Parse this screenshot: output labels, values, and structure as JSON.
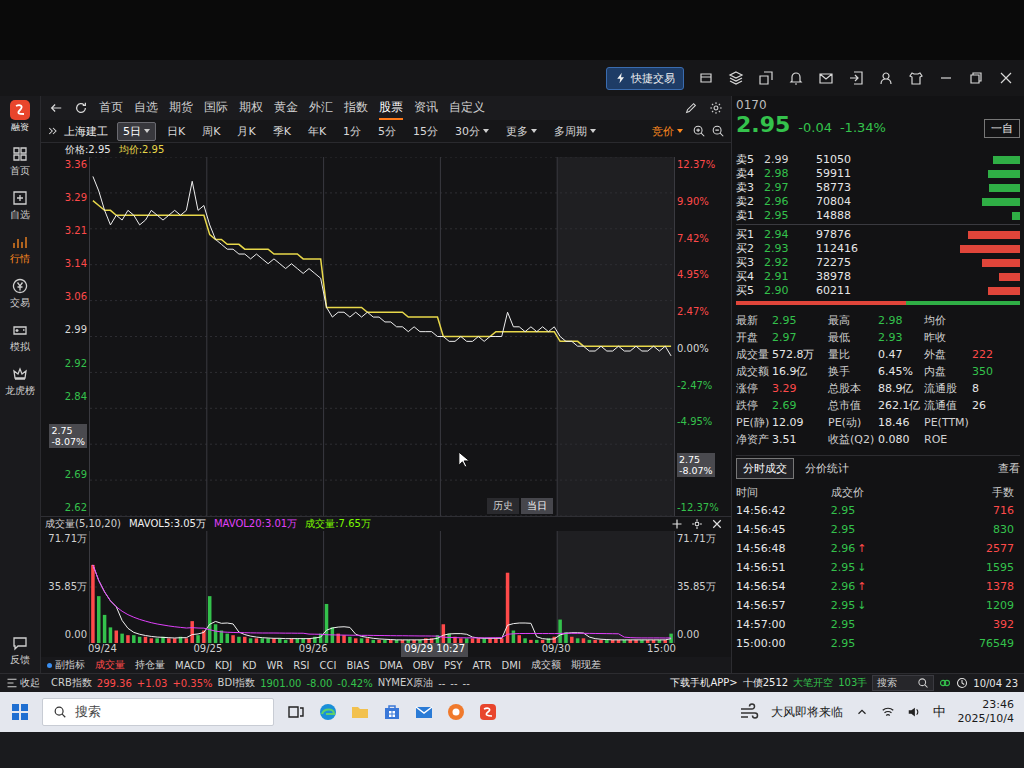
{
  "title_bar": {
    "quick_trade": "快捷交易"
  },
  "sidebar": {
    "logo": "融资",
    "items": [
      {
        "label": "首页",
        "selected": false
      },
      {
        "label": "自选",
        "selected": false
      },
      {
        "label": "行情",
        "selected": true
      },
      {
        "label": "交易",
        "selected": false
      },
      {
        "label": "模拟",
        "selected": false
      },
      {
        "label": "龙虎榜",
        "selected": false
      }
    ],
    "feedback": "反馈"
  },
  "nav": {
    "items": [
      {
        "label": "首页",
        "selected": false
      },
      {
        "label": "自选",
        "selected": false
      },
      {
        "label": "期货",
        "selected": false
      },
      {
        "label": "国际",
        "selected": false
      },
      {
        "label": "期权",
        "selected": false
      },
      {
        "label": "黄金",
        "selected": false
      },
      {
        "label": "外汇",
        "selected": false
      },
      {
        "label": "指数",
        "selected": false
      },
      {
        "label": "股票",
        "selected": true
      },
      {
        "label": "资讯",
        "selected": false
      },
      {
        "label": "自定义",
        "selected": false
      }
    ]
  },
  "toolbar": {
    "stock": "上海建工",
    "periods": [
      {
        "label": "5日",
        "selected": true,
        "dropdown": true
      },
      {
        "label": "日K",
        "selected": false,
        "dropdown": false
      },
      {
        "label": "周K",
        "selected": false,
        "dropdown": false
      },
      {
        "label": "月K",
        "selected": false,
        "dropdown": false
      },
      {
        "label": "季K",
        "selected": false,
        "dropdown": false
      },
      {
        "label": "年K",
        "selected": false,
        "dropdown": false
      },
      {
        "label": "1分",
        "selected": false,
        "dropdown": false
      },
      {
        "label": "5分",
        "selected": false,
        "dropdown": false
      },
      {
        "label": "15分",
        "selected": false,
        "dropdown": false
      },
      {
        "label": "30分",
        "selected": false,
        "dropdown": true
      },
      {
        "label": "更多",
        "selected": false,
        "dropdown": true
      },
      {
        "label": "多周期",
        "selected": false,
        "dropdown": true
      }
    ],
    "auction": "竞价"
  },
  "chart": {
    "header": {
      "price": "价格:2.95",
      "avg": "均价:2.95"
    },
    "left_ticks": [
      {
        "kind": "tick",
        "text": "3.36",
        "color": "#ff4a4a"
      },
      {
        "kind": "tick",
        "text": "3.29",
        "color": "#ff4a4a"
      },
      {
        "kind": "tick",
        "text": "3.21",
        "color": "#ff4a4a"
      },
      {
        "kind": "tick",
        "text": "3.14",
        "color": "#ff4a4a"
      },
      {
        "kind": "tick",
        "text": "3.06",
        "color": "#ff4a4a"
      },
      {
        "kind": "tick",
        "text": "2.99",
        "color": "#d8d8d8"
      },
      {
        "kind": "tick",
        "text": "2.92",
        "color": "#34c24c"
      },
      {
        "kind": "tick",
        "text": "2.84",
        "color": "#34c24c"
      },
      {
        "kind": "cursor",
        "text": "2.75",
        "sub": "-8.07%",
        "color": "#ffffff"
      },
      {
        "kind": "tick",
        "text": "2.69",
        "color": "#34c24c"
      },
      {
        "kind": "tick",
        "text": "2.62",
        "color": "#34c24c"
      }
    ],
    "right_ticks": [
      {
        "kind": "tick",
        "text": "12.37%",
        "color": "#ff4a4a"
      },
      {
        "kind": "tick",
        "text": "9.90%",
        "color": "#ff4a4a"
      },
      {
        "kind": "tick",
        "text": "7.42%",
        "color": "#ff4a4a"
      },
      {
        "kind": "tick",
        "text": "4.95%",
        "color": "#ff4a4a"
      },
      {
        "kind": "tick",
        "text": "2.47%",
        "color": "#ff4a4a"
      },
      {
        "kind": "tick",
        "text": "0.00%",
        "color": "#d8d8d8"
      },
      {
        "kind": "tick",
        "text": "-2.47%",
        "color": "#34c24c"
      },
      {
        "kind": "tick",
        "text": "-4.95%",
        "color": "#34c24c"
      },
      {
        "kind": "cursor",
        "text": "2.75",
        "sub": "-8.07%",
        "color": "#ffffff"
      },
      {
        "kind": "tick",
        "text": "-12.37%",
        "color": "#34c24c"
      }
    ],
    "range": {
      "min": 2.62,
      "max": 3.36
    },
    "days": 5,
    "price": [
      3.32,
      3.29,
      3.25,
      3.22,
      3.24,
      3.23,
      3.25,
      3.24,
      3.22,
      3.23,
      3.25,
      3.24,
      3.23,
      3.24,
      3.25,
      3.24,
      3.25,
      3.31,
      3.25,
      3.26,
      3.22,
      3.19,
      3.18,
      3.17,
      3.17,
      3.16,
      3.16,
      3.15,
      3.16,
      3.15,
      3.14,
      3.15,
      3.14,
      3.13,
      3.14,
      3.13,
      3.12,
      3.13,
      3.12,
      3.11,
      3.05,
      3.03,
      3.04,
      3.04,
      3.03,
      3.04,
      3.03,
      3.04,
      3.03,
      3.03,
      3.02,
      3.02,
      3.01,
      3.01,
      3.0,
      3.01,
      3.0,
      3.0,
      3.0,
      2.99,
      2.99,
      2.98,
      2.98,
      2.99,
      2.98,
      2.98,
      2.99,
      2.98,
      2.99,
      2.99,
      2.99,
      3.04,
      3.01,
      3.01,
      3.0,
      3.01,
      3.0,
      3.01,
      3.0,
      3.01,
      2.99,
      2.98,
      2.98,
      2.97,
      2.97,
      2.96,
      2.96,
      2.97,
      2.96,
      2.96,
      2.97,
      2.96,
      2.96,
      2.97,
      2.96,
      2.96,
      2.97,
      2.96,
      2.97,
      2.95
    ],
    "avg": [
      3.27,
      3.26,
      3.25,
      3.25,
      3.24,
      3.24,
      3.24,
      3.24,
      3.24,
      3.24,
      3.24,
      3.24,
      3.24,
      3.24,
      3.24,
      3.24,
      3.24,
      3.24,
      3.24,
      3.24,
      3.2,
      3.19,
      3.19,
      3.18,
      3.18,
      3.18,
      3.17,
      3.17,
      3.17,
      3.17,
      3.17,
      3.16,
      3.16,
      3.16,
      3.16,
      3.16,
      3.15,
      3.15,
      3.15,
      3.15,
      3.05,
      3.05,
      3.05,
      3.05,
      3.05,
      3.05,
      3.05,
      3.04,
      3.04,
      3.04,
      3.04,
      3.04,
      3.04,
      3.04,
      3.03,
      3.03,
      3.03,
      3.03,
      3.03,
      3.03,
      2.99,
      2.99,
      2.99,
      2.99,
      2.99,
      2.99,
      2.99,
      2.99,
      2.99,
      3.0,
      3.0,
      3.0,
      3.0,
      3.0,
      3.0,
      3.0,
      3.0,
      3.0,
      3.0,
      3.0,
      2.98,
      2.98,
      2.98,
      2.98,
      2.97,
      2.97,
      2.97,
      2.97,
      2.97,
      2.97,
      2.97,
      2.97,
      2.97,
      2.97,
      2.97,
      2.97,
      2.97,
      2.97,
      2.97,
      2.97
    ],
    "buttons": [
      {
        "label": "历史",
        "selected": false
      },
      {
        "label": "当日",
        "selected": true
      }
    ]
  },
  "volume": {
    "header": [
      {
        "text": "成交量(5,10,20)",
        "color": "#d0d0d0"
      },
      {
        "text": "MAVOL5:3.05万",
        "color": "#f0f0f0"
      },
      {
        "text": "MAVOL20:3.01万",
        "color": "#e040fb"
      },
      {
        "text": "成交量:7.65万",
        "color": "#7cfc00"
      }
    ],
    "left_ticks": [
      "71.71万",
      "35.85万",
      "0.00"
    ],
    "right_ticks": [
      "71.71万",
      "35.85万",
      "0.00"
    ],
    "max": 71.71,
    "values": [
      50,
      30,
      18,
      10,
      8,
      6,
      5,
      5,
      4,
      4,
      3,
      3,
      4,
      3,
      3,
      4,
      3,
      14,
      5,
      8,
      30,
      12,
      8,
      6,
      5,
      4,
      4,
      3,
      3,
      3,
      3,
      3,
      3,
      2,
      3,
      3,
      3,
      3,
      4,
      6,
      25,
      10,
      6,
      5,
      4,
      3,
      3,
      3,
      2,
      2,
      2,
      2,
      2,
      2,
      2,
      2,
      2,
      3,
      3,
      5,
      12,
      6,
      4,
      3,
      3,
      3,
      3,
      3,
      3,
      3,
      3,
      45,
      8,
      5,
      3,
      2,
      2,
      2,
      3,
      4,
      15,
      7,
      4,
      3,
      3,
      2,
      2,
      2,
      2,
      2,
      2,
      2,
      2,
      2,
      2,
      2,
      2,
      2,
      2,
      6
    ],
    "dates": [
      {
        "text": "09/24",
        "selected": false
      },
      {
        "text": "09/25",
        "selected": false
      },
      {
        "text": "09/26",
        "selected": false
      },
      {
        "text": "09/29 10:27",
        "selected": true
      },
      {
        "text": "09/30",
        "selected": false
      },
      {
        "text": "15:00",
        "selected": false
      }
    ]
  },
  "indicators": {
    "label": "副指标",
    "tabs": [
      {
        "label": "成交量",
        "selected": true
      },
      {
        "label": "持仓量",
        "selected": false
      },
      {
        "label": "MACD",
        "selected": false
      },
      {
        "label": "KDJ",
        "selected": false
      },
      {
        "label": "KD",
        "selected": false
      },
      {
        "label": "WR",
        "selected": false
      },
      {
        "label": "RSI",
        "selected": false
      },
      {
        "label": "CCI",
        "selected": false
      },
      {
        "label": "BIAS",
        "selected": false
      },
      {
        "label": "DMA",
        "selected": false
      },
      {
        "label": "OBV",
        "selected": false
      },
      {
        "label": "PSY",
        "selected": false
      },
      {
        "label": "ATR",
        "selected": false
      },
      {
        "label": "DMI",
        "selected": false
      },
      {
        "label": "成交额",
        "selected": false
      },
      {
        "label": "期现差",
        "selected": false
      }
    ]
  },
  "quote": {
    "code": "0170",
    "price": "2.95",
    "change": "-0.04",
    "pct": "-1.34%",
    "color": "#34c24c",
    "button": "一自"
  },
  "order_book": {
    "asks": [
      {
        "label": "卖5",
        "price": "2.99",
        "price_color": "#d8d8d8",
        "volume": "51050",
        "level": 0.45
      },
      {
        "label": "卖4",
        "price": "2.98",
        "price_color": "#34c24c",
        "volume": "59911",
        "level": 0.53
      },
      {
        "label": "卖3",
        "price": "2.97",
        "price_color": "#34c24c",
        "volume": "58773",
        "level": 0.52
      },
      {
        "label": "卖2",
        "price": "2.96",
        "price_color": "#34c24c",
        "volume": "70804",
        "level": 0.63
      },
      {
        "label": "卖1",
        "price": "2.95",
        "price_color": "#34c24c",
        "volume": "14888",
        "level": 0.13
      }
    ],
    "bids": [
      {
        "label": "买1",
        "price": "2.94",
        "price_color": "#34c24c",
        "volume": "97876",
        "level": 0.87
      },
      {
        "label": "买2",
        "price": "2.93",
        "price_color": "#34c24c",
        "volume": "112416",
        "level": 1.0
      },
      {
        "label": "买3",
        "price": "2.92",
        "price_color": "#34c24c",
        "volume": "72275",
        "level": 0.64
      },
      {
        "label": "买4",
        "price": "2.91",
        "price_color": "#34c24c",
        "volume": "38978",
        "level": 0.35
      },
      {
        "label": "买5",
        "price": "2.90",
        "price_color": "#34c24c",
        "volume": "60211",
        "level": 0.54
      }
    ],
    "ratio": {
      "level": 0.6
    }
  },
  "stats": [
    [
      {
        "label": "最新",
        "value": "2.95",
        "color": "#34c24c"
      },
      {
        "label": "最高",
        "value": "2.98",
        "color": "#34c24c"
      },
      {
        "label": "均价"
      }
    ],
    [
      {
        "label": "开盘",
        "value": "2.97",
        "color": "#34c24c"
      },
      {
        "label": "最低",
        "value": "2.93",
        "color": "#34c24c"
      },
      {
        "label": "昨收"
      }
    ],
    [
      {
        "label": "成交量",
        "value": "572.8万",
        "color": "#e6e6e6"
      },
      {
        "label": "量比",
        "value": "0.47",
        "color": "#e6e6e6"
      },
      {
        "label": "外盘",
        "value": "222",
        "color": "#ff4a4a"
      }
    ],
    [
      {
        "label": "成交额",
        "value": "16.9亿",
        "color": "#e6e6e6"
      },
      {
        "label": "换手",
        "value": "6.45%",
        "color": "#e6e6e6"
      },
      {
        "label": "内盘",
        "value": "350",
        "color": "#34c24c"
      }
    ],
    [
      {
        "label": "涨停",
        "value": "3.29",
        "color": "#ff4a4a"
      },
      {
        "label": "总股本",
        "value": "88.9亿",
        "color": "#e6e6e6"
      },
      {
        "label": "流通股",
        "value": "8",
        "color": "#e6e6e6"
      }
    ],
    [
      {
        "label": "跌停",
        "value": "2.69",
        "color": "#34c24c"
      },
      {
        "label": "总市值",
        "value": "262.1亿",
        "color": "#e6e6e6"
      },
      {
        "label": "流通值",
        "value": "26",
        "color": "#e6e6e6"
      }
    ],
    [
      {
        "label": "PE(静)",
        "value": "12.09",
        "color": "#e6e6e6"
      },
      {
        "label": "PE(动)",
        "value": "18.46",
        "color": "#e6e6e6"
      },
      {
        "label": "PE(TTM)"
      }
    ],
    [
      {
        "label": "净资产",
        "value": "3.51",
        "color": "#e6e6e6"
      },
      {
        "label": "收益(Q2)",
        "value": "0.080",
        "color": "#e6e6e6"
      },
      {
        "label": "ROE"
      }
    ]
  ],
  "trades": {
    "tabs": [
      {
        "label": "分时成交",
        "selected": true
      },
      {
        "label": "分价统计",
        "selected": false
      }
    ],
    "more": "查看",
    "columns": [
      "时间",
      "成交价",
      "手数"
    ],
    "rows": [
      {
        "time": "14:56:42",
        "price": "2.95",
        "price_color": "#34c24c",
        "qty": "716",
        "qty_color": "#ff4a4a"
      },
      {
        "time": "14:56:45",
        "price": "2.95",
        "price_color": "#34c24c",
        "qty": "830",
        "qty_color": "#34c24c"
      },
      {
        "time": "14:56:48",
        "price": "2.96",
        "price_color": "#34c24c",
        "arrow": "↑",
        "arrow_color": "#ff4a4a",
        "qty": "2577",
        "qty_color": "#ff4a4a"
      },
      {
        "time": "14:56:51",
        "price": "2.95",
        "price_color": "#34c24c",
        "arrow": "↓",
        "arrow_color": "#34c24c",
        "qty": "1595",
        "qty_color": "#34c24c"
      },
      {
        "time": "14:56:54",
        "price": "2.96",
        "price_color": "#34c24c",
        "arrow": "↑",
        "arrow_color": "#ff4a4a",
        "qty": "1378",
        "qty_color": "#ff4a4a"
      },
      {
        "time": "14:56:57",
        "price": "2.95",
        "price_color": "#34c24c",
        "arrow": "↓",
        "arrow_color": "#34c24c",
        "qty": "1209",
        "qty_color": "#34c24c"
      },
      {
        "time": "14:57:00",
        "price": "2.95",
        "price_color": "#34c24c",
        "qty": "392",
        "qty_color": "#ff4a4a"
      },
      {
        "time": "15:00:00",
        "price": "2.95",
        "price_color": "#34c24c",
        "qty": "76549",
        "qty_color": "#34c24c"
      }
    ]
  },
  "status_bar": {
    "collapse": "收起",
    "markets": [
      {
        "text": "CRB指数",
        "color": "#cfcfcf"
      },
      {
        "text": "299.36",
        "color": "#ff4a4a"
      },
      {
        "text": "+1.03",
        "color": "#ff4a4a"
      },
      {
        "text": "+0.35%",
        "color": "#ff4a4a"
      },
      {
        "text": "BDI指数",
        "color": "#cfcfcf"
      },
      {
        "text": "1901.00",
        "color": "#34c24c"
      },
      {
        "text": "-8.00",
        "color": "#34c24c"
      },
      {
        "text": "-0.42%",
        "color": "#34c24c"
      },
      {
        "text": "NYMEX原油",
        "color": "#cfcfcf"
      },
      {
        "text": "--",
        "color": "#cfcfcf"
      },
      {
        "text": "--",
        "color": "#cfcfcf"
      },
      {
        "text": "--",
        "color": "#cfcfcf"
      }
    ],
    "right": [
      {
        "text": "下载手机APP>",
        "color": "#f0f0f0"
      },
      {
        "text": "十债2512",
        "color": "#f0f0f0"
      },
      {
        "text": "大笔开空",
        "color": "#34c24c"
      },
      {
        "text": "103手",
        "color": "#34c24c"
      }
    ],
    "search": {
      "placeholder": "搜索"
    },
    "clock": "10/04 23"
  },
  "taskbar": {
    "search": {
      "placeholder": "搜索"
    },
    "weather": "大风即将来临",
    "ime": "中",
    "time": "23:46",
    "date": "2025/10/4"
  }
}
